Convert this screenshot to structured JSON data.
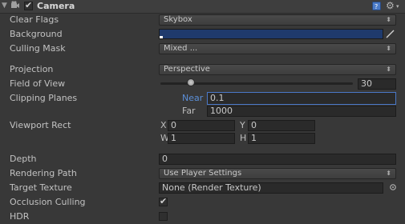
{
  "component": {
    "title": "Camera",
    "enabled": true
  },
  "icons": {
    "collapse": "triangle-down-icon",
    "camera": "camera-icon",
    "help": "book-help-icon",
    "settings": "gear-icon",
    "picker": "eyedropper-icon",
    "target": "object-picker-icon"
  },
  "fields": {
    "clear_flags": {
      "label": "Clear Flags",
      "value": "Skybox"
    },
    "background": {
      "label": "Background",
      "color": "#1f3a6c"
    },
    "culling_mask": {
      "label": "Culling Mask",
      "value": "Mixed ..."
    },
    "projection": {
      "label": "Projection",
      "value": "Perspective"
    },
    "field_of_view": {
      "label": "Field of View",
      "value": "30",
      "slider_fraction": 0.2
    },
    "clipping_planes": {
      "label": "Clipping Planes",
      "near_label": "Near",
      "near_value": "0.1",
      "far_label": "Far",
      "far_value": "1000"
    },
    "viewport_rect": {
      "label": "Viewport Rect",
      "x_label": "X",
      "x": "0",
      "y_label": "Y",
      "y": "0",
      "w_label": "W",
      "w": "1",
      "h_label": "H",
      "h": "1"
    },
    "depth": {
      "label": "Depth",
      "value": "0"
    },
    "rendering_path": {
      "label": "Rendering Path",
      "value": "Use Player Settings"
    },
    "target_texture": {
      "label": "Target Texture",
      "value": "None (Render Texture)"
    },
    "occlusion_culling": {
      "label": "Occlusion Culling",
      "checked": true
    },
    "hdr": {
      "label": "HDR",
      "checked": false
    }
  },
  "colors": {
    "accent": "#3c5fa8",
    "panel": "#383838"
  }
}
